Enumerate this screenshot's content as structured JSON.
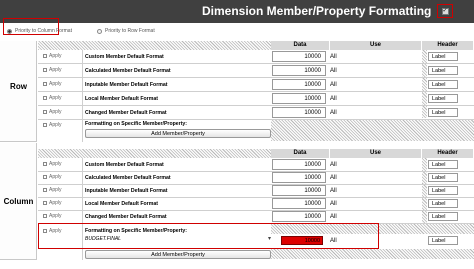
{
  "title": "Dimension Member/Property Formatting",
  "priority": {
    "column_label": "Priority to Column Format",
    "row_label": "Priority to Row Format",
    "selected": "column"
  },
  "columns": {
    "data": "Data",
    "use": "Use",
    "header": "Header"
  },
  "sections": {
    "row": {
      "label": "Row",
      "rows": [
        {
          "apply": "Apply",
          "name": "Custom Member Default Format",
          "data": "10000",
          "use": "All",
          "header": "Label"
        },
        {
          "apply": "Apply",
          "name": "Calculated Member Default Format",
          "data": "10000",
          "use": "All",
          "header": "Label"
        },
        {
          "apply": "Apply",
          "name": "Inputable Member Default Format",
          "data": "10000",
          "use": "All",
          "header": "Label"
        },
        {
          "apply": "Apply",
          "name": "Local Member Default Format",
          "data": "10000",
          "use": "All",
          "header": "Label"
        },
        {
          "apply": "Apply",
          "name": "Changed Member Default Format",
          "data": "10000",
          "use": "All",
          "header": "Label"
        }
      ],
      "specific": {
        "apply": "Apply",
        "name": "Formatting on Specific Member/Property:",
        "button": "Add Member/Property"
      }
    },
    "column": {
      "label": "Column",
      "rows": [
        {
          "apply": "Apply",
          "name": "Custom Member Default Format",
          "data": "10000",
          "use": "All",
          "header": "Label"
        },
        {
          "apply": "Apply",
          "name": "Calculated Member Default Format",
          "data": "10000",
          "use": "All",
          "header": "Label"
        },
        {
          "apply": "Apply",
          "name": "Inputable Member Default Format",
          "data": "10000",
          "use": "All",
          "header": "Label"
        },
        {
          "apply": "Apply",
          "name": "Local Member Default Format",
          "data": "10000",
          "use": "All",
          "header": "Label"
        },
        {
          "apply": "Apply",
          "name": "Changed Member Default Format",
          "data": "10000",
          "use": "All",
          "header": "Label"
        }
      ],
      "specific": {
        "apply": "Apply",
        "name": "Formatting on Specific Member/Property:",
        "member": "BUDGET.FINAL",
        "data": "10000",
        "use": "All",
        "header": "Label",
        "button": "Add Member/Property",
        "highlight_color": "#dd0000"
      }
    }
  },
  "colors": {
    "title_bar": "#404040",
    "accent_red": "#d00000"
  }
}
